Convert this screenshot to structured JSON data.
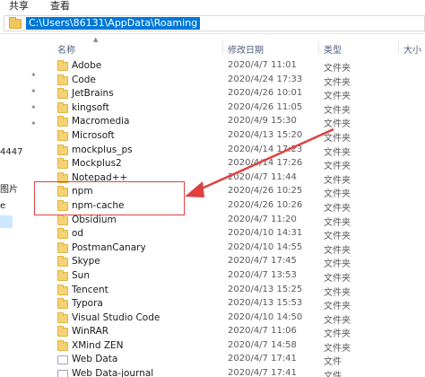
{
  "ribbon": {
    "share_tab": "共享",
    "view_tab": "查看"
  },
  "address": {
    "path": "C:\\Users\\86131\\AppData\\Roaming"
  },
  "nav": {
    "frag1": "4447",
    "frag2": "图片",
    "frag3": "e"
  },
  "columns": {
    "name": "名称",
    "date": "修改日期",
    "type": "类型",
    "size": "大小"
  },
  "files": [
    {
      "name": "Adobe",
      "date": "2020/4/7 11:01",
      "type": "文件夹",
      "kind": "folder"
    },
    {
      "name": "Code",
      "date": "2020/4/24 17:33",
      "type": "文件夹",
      "kind": "folder"
    },
    {
      "name": "JetBrains",
      "date": "2020/4/26 10:01",
      "type": "文件夹",
      "kind": "folder"
    },
    {
      "name": "kingsoft",
      "date": "2020/4/26 11:05",
      "type": "文件夹",
      "kind": "folder"
    },
    {
      "name": "Macromedia",
      "date": "2020/4/9 15:30",
      "type": "文件夹",
      "kind": "folder"
    },
    {
      "name": "Microsoft",
      "date": "2020/4/13 15:20",
      "type": "文件夹",
      "kind": "folder"
    },
    {
      "name": "mockplus_ps",
      "date": "2020/4/14 17:23",
      "type": "文件夹",
      "kind": "folder"
    },
    {
      "name": "Mockplus2",
      "date": "2020/4/14 17:26",
      "type": "文件夹",
      "kind": "folder"
    },
    {
      "name": "Notepad++",
      "date": "2020/4/7 11:44",
      "type": "文件夹",
      "kind": "folder"
    },
    {
      "name": "npm",
      "date": "2020/4/26 10:25",
      "type": "文件夹",
      "kind": "folder"
    },
    {
      "name": "npm-cache",
      "date": "2020/4/26 10:26",
      "type": "文件夹",
      "kind": "folder"
    },
    {
      "name": "Obsidium",
      "date": "2020/4/7 11:20",
      "type": "文件夹",
      "kind": "folder"
    },
    {
      "name": "od",
      "date": "2020/4/10 14:31",
      "type": "文件夹",
      "kind": "folder"
    },
    {
      "name": "PostmanCanary",
      "date": "2020/4/10 14:55",
      "type": "文件夹",
      "kind": "folder"
    },
    {
      "name": "Skype",
      "date": "2020/4/7 17:45",
      "type": "文件夹",
      "kind": "folder"
    },
    {
      "name": "Sun",
      "date": "2020/4/7 13:53",
      "type": "文件夹",
      "kind": "folder"
    },
    {
      "name": "Tencent",
      "date": "2020/4/13 15:25",
      "type": "文件夹",
      "kind": "folder"
    },
    {
      "name": "Typora",
      "date": "2020/4/13 15:53",
      "type": "文件夹",
      "kind": "folder"
    },
    {
      "name": "Visual Studio Code",
      "date": "2020/4/10 14:50",
      "type": "文件夹",
      "kind": "folder"
    },
    {
      "name": "WinRAR",
      "date": "2020/4/7 11:06",
      "type": "文件夹",
      "kind": "folder"
    },
    {
      "name": "XMind ZEN",
      "date": "2020/4/7 14:58",
      "type": "文件夹",
      "kind": "folder"
    },
    {
      "name": "Web Data",
      "date": "2020/4/7 17:41",
      "type": "文件",
      "kind": "file"
    },
    {
      "name": "Web Data-journal",
      "date": "2020/4/7 17:41",
      "type": "文件",
      "kind": "file"
    }
  ],
  "colors": {
    "selection": "#0078d7",
    "highlight": "#e04040",
    "folder": "#f5d374"
  }
}
